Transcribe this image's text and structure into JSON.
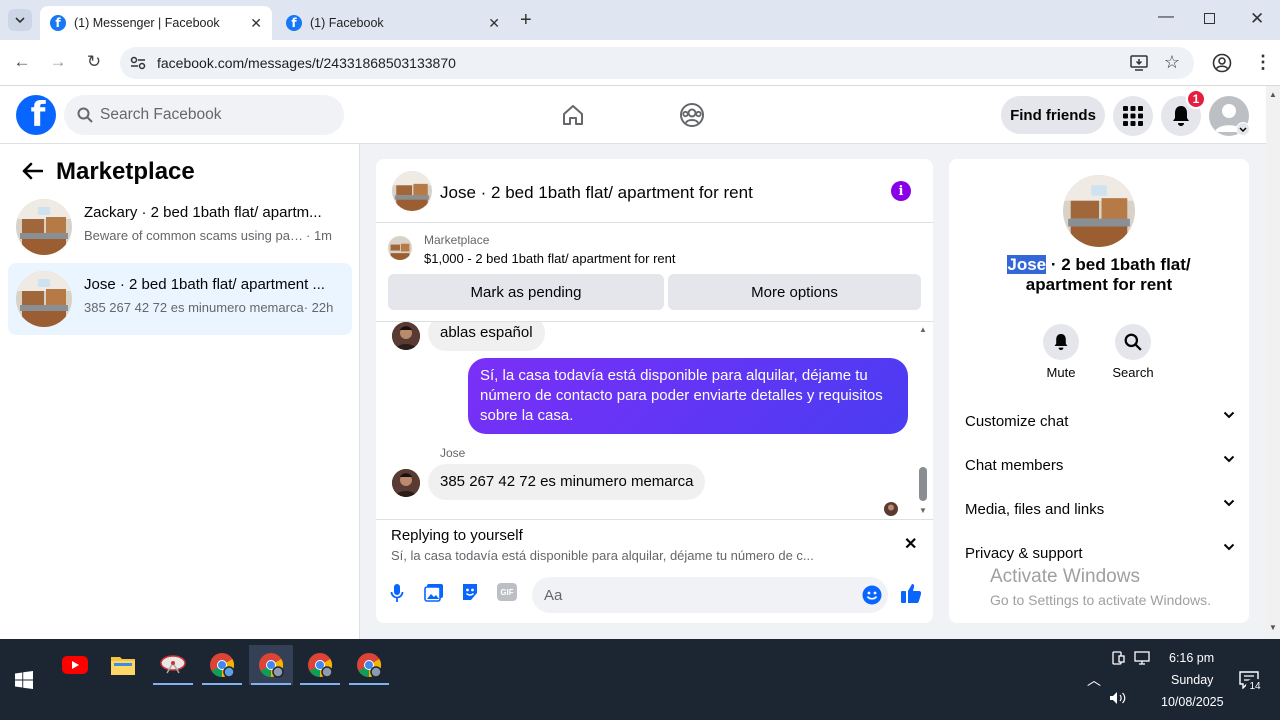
{
  "browser": {
    "tabs": [
      {
        "label": "(1) Messenger | Facebook",
        "active": true
      },
      {
        "label": "(1) Facebook",
        "active": false
      }
    ],
    "url": "facebook.com/messages/t/24331868503133870"
  },
  "fb_header": {
    "search_placeholder": "Search Facebook",
    "find_friends": "Find friends",
    "notification_count": "1"
  },
  "left_panel": {
    "title": "Marketplace",
    "conversations": [
      {
        "title": "Zackary · 2 bed 1bath flat/ apartm...",
        "snippet": "Beware of common scams using pay...",
        "time": "· 1m",
        "selected": false
      },
      {
        "title": "Jose · 2 bed 1bath flat/ apartment ...",
        "snippet": "385 267 42 72 es minumero memarca",
        "time": "· 22h",
        "selected": true
      }
    ]
  },
  "chat": {
    "title": "Jose · 2 bed 1bath flat/ apartment for rent",
    "listing_source": "Marketplace",
    "listing_text": "$1,000 - 2 bed 1bath flat/ apartment for rent",
    "mark_pending": "Mark as pending",
    "more_options": "More options",
    "messages": [
      {
        "from": "them",
        "text": "ablas español"
      },
      {
        "from": "me",
        "text": "Sí, la casa todavía está disponible para alquilar, déjame tu número de contacto para poder enviarte detalles y requisitos sobre la casa."
      },
      {
        "from": "them",
        "sender": "Jose",
        "text": "385 267 42 72 es minumero memarca"
      }
    ],
    "replying_label": "Replying to yourself",
    "replying_text": "Sí, la casa todavía está disponible para alquilar, déjame tu número de c...",
    "composer_placeholder": "Aa"
  },
  "right_panel": {
    "name_highlight": "Jose",
    "name_rest": " · 2 bed 1bath flat/",
    "name_line2": "apartment for rent",
    "mute": "Mute",
    "search": "Search",
    "sections": [
      "Customize chat",
      "Chat members",
      "Media, files and links",
      "Privacy & support"
    ]
  },
  "watermark": {
    "line1": "Activate Windows",
    "line2": "Go to Settings to activate Windows."
  },
  "taskbar": {
    "time": "6:16 pm",
    "day": "Sunday",
    "date": "10/08/2025",
    "notification_count": "14"
  },
  "colors": {
    "facebook_blue": "#0866ff",
    "messenger_purple": "#7b2ff7",
    "notification_red": "#e41e3f"
  }
}
